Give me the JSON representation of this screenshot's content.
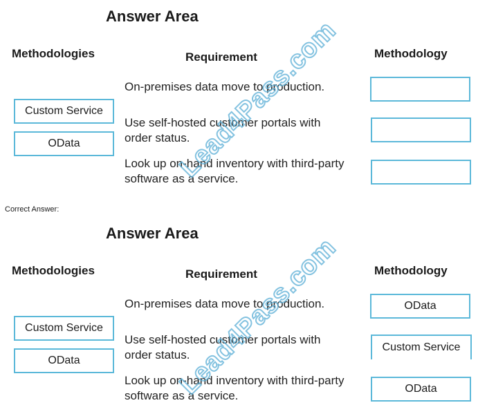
{
  "watermark": "Lead4Pass.com",
  "correct_answer_label": "Correct Answer:",
  "sections": [
    {
      "title": "Answer Area",
      "methodologies_heading": "Methodologies",
      "requirement_heading": "Requirement",
      "methodology_heading": "Methodology",
      "methodologies": [
        "Custom Service",
        "OData"
      ],
      "requirements": [
        {
          "text_line1": "On-premises data move to production.",
          "text_line2": "",
          "answer": ""
        },
        {
          "text_line1": "Use self-hosted customer portals with",
          "text_line2": "order status.",
          "answer": ""
        },
        {
          "text_line1": "Look up on-hand inventory with third-party",
          "text_line2": "software as a service.",
          "answer": ""
        }
      ]
    },
    {
      "title": "Answer Area",
      "methodologies_heading": "Methodologies",
      "requirement_heading": "Requirement",
      "methodology_heading": "Methodology",
      "methodologies": [
        "Custom Service",
        "OData"
      ],
      "requirements": [
        {
          "text_line1": "On-premises data move to production.",
          "text_line2": "",
          "answer": "OData"
        },
        {
          "text_line1": "Use self-hosted customer portals with",
          "text_line2": "order status.",
          "answer": "Custom Service"
        },
        {
          "text_line1": "Look up on-hand inventory with third-party",
          "text_line2": "software as a service.",
          "answer": "OData"
        }
      ]
    }
  ]
}
